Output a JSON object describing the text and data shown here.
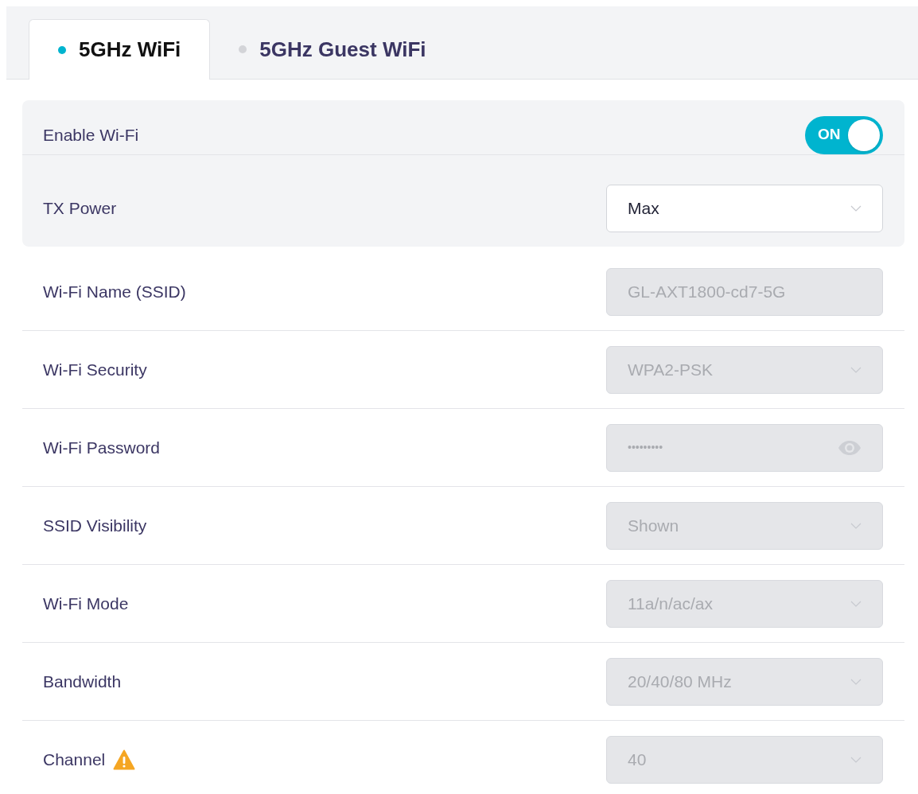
{
  "tabs": [
    {
      "label": "5GHz WiFi",
      "selected": true
    },
    {
      "label": "5GHz Guest WiFi",
      "selected": false
    }
  ],
  "primary_settings": [
    {
      "kind": "toggle",
      "label": "Enable Wi-Fi",
      "on": true,
      "on_text": "ON"
    },
    {
      "kind": "select",
      "label": "TX Power",
      "value": "Max",
      "disabled": false
    }
  ],
  "settings": [
    {
      "kind": "input",
      "label": "Wi-Fi Name (SSID)",
      "value": "GL-AXT1800-cd7-5G",
      "disabled": true,
      "warning": false
    },
    {
      "kind": "select",
      "label": "Wi-Fi Security",
      "value": "WPA2-PSK",
      "disabled": true,
      "warning": false
    },
    {
      "kind": "password",
      "label": "Wi-Fi Password",
      "value": "•••••••••",
      "disabled": true,
      "warning": false
    },
    {
      "kind": "select",
      "label": "SSID Visibility",
      "value": "Shown",
      "disabled": true,
      "warning": false
    },
    {
      "kind": "select",
      "label": "Wi-Fi Mode",
      "value": "11a/n/ac/ax",
      "disabled": true,
      "warning": false
    },
    {
      "kind": "select",
      "label": "Bandwidth",
      "value": "20/40/80 MHz",
      "disabled": true,
      "warning": false
    },
    {
      "kind": "select",
      "label": "Channel",
      "value": "40",
      "disabled": true,
      "warning": true
    }
  ]
}
